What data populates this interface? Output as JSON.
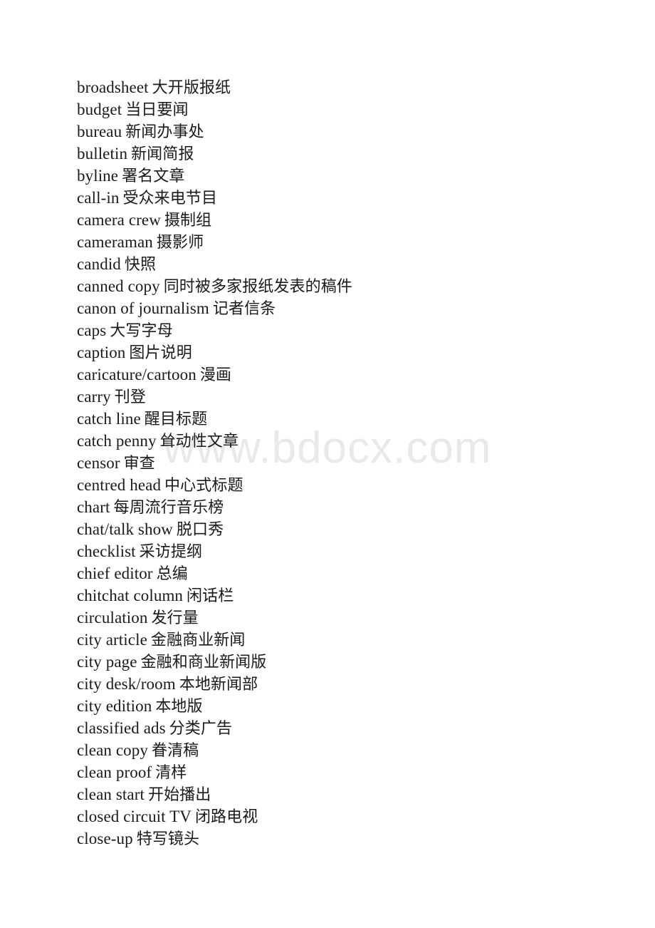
{
  "page": {
    "background_color": "#ffffff",
    "text_color": "#1a1a1a"
  },
  "watermark": {
    "text": "www.bdocx.com",
    "color": "#e9e9e9"
  },
  "glossary": {
    "entries": [
      {
        "term": "broadsheet",
        "gloss": "大开版报纸"
      },
      {
        "term": "budget",
        "gloss": "当日要闻"
      },
      {
        "term": "bureau",
        "gloss": "新闻办事处"
      },
      {
        "term": "bulletin",
        "gloss": "新闻简报"
      },
      {
        "term": "byline",
        "gloss": "署名文章"
      },
      {
        "term": "call-in",
        "gloss": "受众来电节目"
      },
      {
        "term": "camera crew",
        "gloss": "摄制组"
      },
      {
        "term": "cameraman",
        "gloss": "摄影师"
      },
      {
        "term": "candid",
        "gloss": "快照"
      },
      {
        "term": "canned copy",
        "gloss": "同时被多家报纸发表的稿件"
      },
      {
        "term": "canon of journalism",
        "gloss": "记者信条"
      },
      {
        "term": "caps",
        "gloss": "大写字母"
      },
      {
        "term": "caption",
        "gloss": "图片说明"
      },
      {
        "term": "caricature/cartoon",
        "gloss": "漫画"
      },
      {
        "term": "carry",
        "gloss": "刊登"
      },
      {
        "term": "catch line",
        "gloss": "醒目标题"
      },
      {
        "term": "catch penny",
        "gloss": "耸动性文章"
      },
      {
        "term": "censor",
        "gloss": "审查"
      },
      {
        "term": "centred head",
        "gloss": "中心式标题"
      },
      {
        "term": "chart",
        "gloss": "每周流行音乐榜"
      },
      {
        "term": "chat/talk show",
        "gloss": "脱口秀"
      },
      {
        "term": "checklist",
        "gloss": "采访提纲"
      },
      {
        "term": "chief editor",
        "gloss": "总编"
      },
      {
        "term": "chitchat column",
        "gloss": "闲话栏"
      },
      {
        "term": "circulation",
        "gloss": "发行量"
      },
      {
        "term": "city article",
        "gloss": "金融商业新闻"
      },
      {
        "term": "city page",
        "gloss": "金融和商业新闻版"
      },
      {
        "term": "city desk/room",
        "gloss": "本地新闻部"
      },
      {
        "term": "city edition",
        "gloss": "本地版"
      },
      {
        "term": "classified ads",
        "gloss": "分类广告"
      },
      {
        "term": "clean copy",
        "gloss": "眷清稿"
      },
      {
        "term": "clean proof",
        "gloss": "清样"
      },
      {
        "term": "clean start",
        "gloss": "开始播出"
      },
      {
        "term": "closed circuit TV",
        "gloss": "闭路电视"
      },
      {
        "term": "close-up",
        "gloss": "特写镜头"
      }
    ]
  }
}
